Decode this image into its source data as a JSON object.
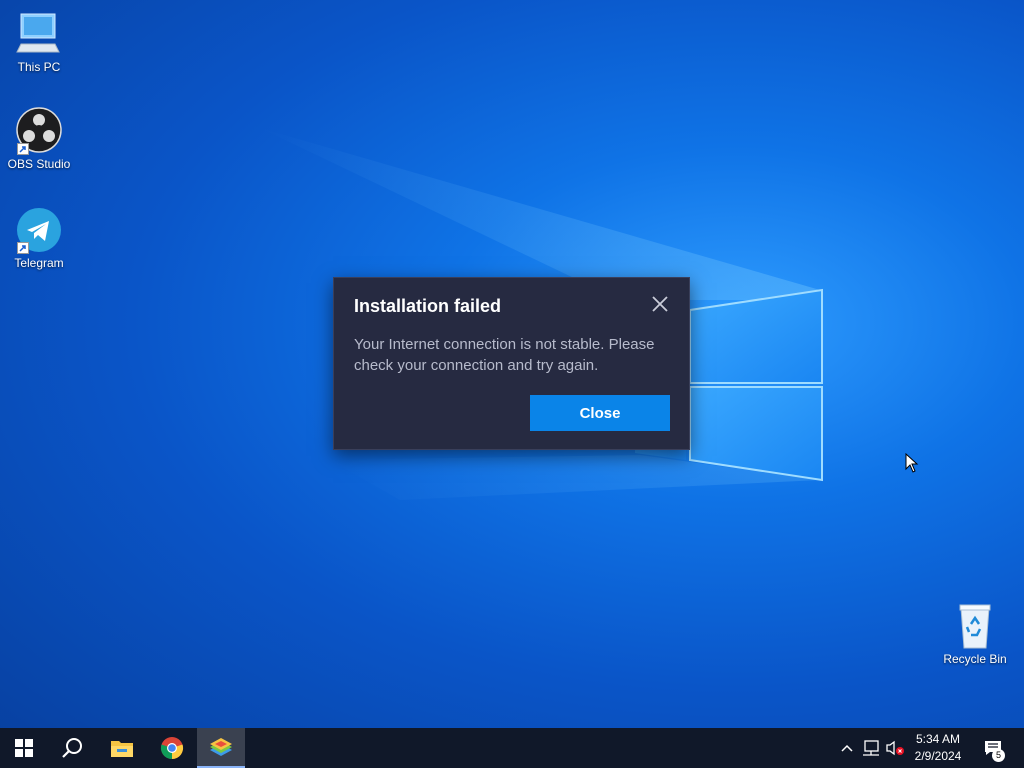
{
  "desktop": {
    "icons": [
      {
        "label": "This PC",
        "icon": "this-pc-icon"
      },
      {
        "label": "OBS Studio",
        "icon": "obs-studio-icon"
      },
      {
        "label": "Telegram",
        "icon": "telegram-icon"
      },
      {
        "label": "Recycle Bin",
        "icon": "recycle-bin-icon"
      }
    ]
  },
  "dialog": {
    "title": "Installation failed",
    "message": "Your Internet connection is not stable. Please check your connection and try again.",
    "close_button_label": "Close",
    "close_icon": "close-icon",
    "colors": {
      "background": "#262a41",
      "button": "#0a84e8",
      "message_text": "#b7bbcc"
    }
  },
  "taskbar": {
    "items": [
      {
        "name": "start",
        "icon": "windows-start-icon"
      },
      {
        "name": "search",
        "icon": "search-icon"
      },
      {
        "name": "file-explorer",
        "icon": "folder-icon"
      },
      {
        "name": "chrome",
        "icon": "chrome-icon"
      },
      {
        "name": "bluestacks",
        "icon": "bluestacks-icon",
        "active": true
      }
    ],
    "tray": {
      "icons": [
        "chevron-up-icon",
        "network-icon",
        "volume-muted-icon"
      ],
      "time": "5:34 AM",
      "date": "2/9/2024",
      "notification_count": "5"
    }
  }
}
